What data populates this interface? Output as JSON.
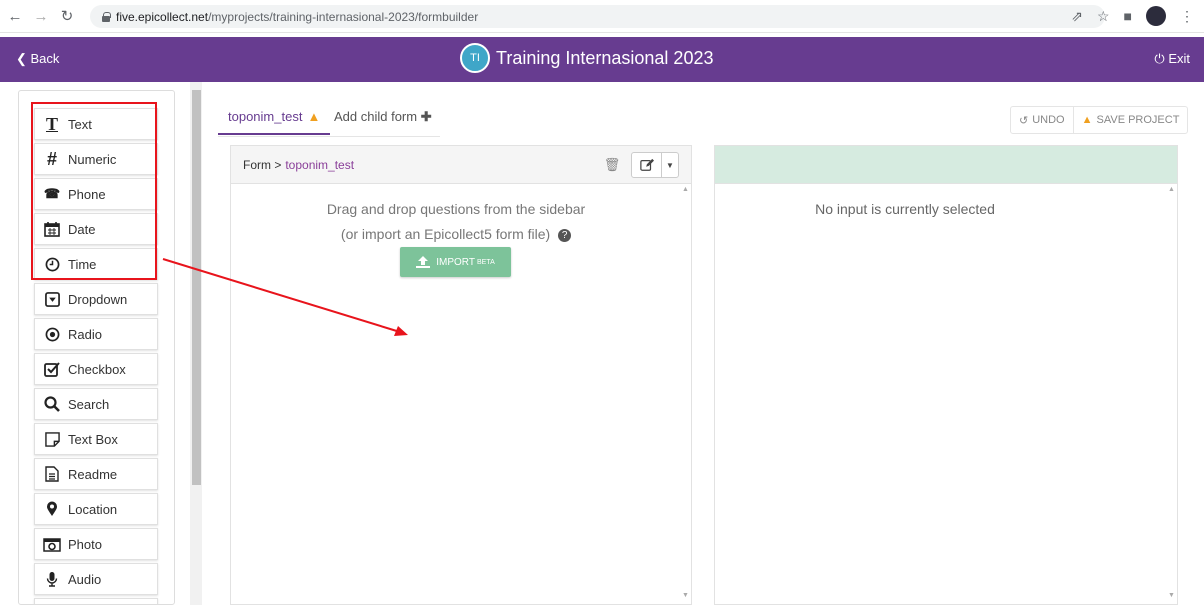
{
  "browser": {
    "url_host": "five.epicollect.net",
    "url_path": "/myprojects/training-internasional-2023/formbuilder"
  },
  "header": {
    "back_label": "Back",
    "avatar_initials": "TI",
    "title": "Training Internasional 2023",
    "exit_label": "Exit",
    "color": "#673c90"
  },
  "sidebar": {
    "items": [
      {
        "label": "Text",
        "icon": "text-icon"
      },
      {
        "label": "Numeric",
        "icon": "hash-icon"
      },
      {
        "label": "Phone",
        "icon": "phone-icon"
      },
      {
        "label": "Date",
        "icon": "calendar-icon"
      },
      {
        "label": "Time",
        "icon": "clock-icon"
      },
      {
        "label": "Dropdown",
        "icon": "dropdown-icon"
      },
      {
        "label": "Radio",
        "icon": "radio-icon"
      },
      {
        "label": "Checkbox",
        "icon": "checkbox-icon"
      },
      {
        "label": "Search",
        "icon": "search-icon"
      },
      {
        "label": "Text Box",
        "icon": "textbox-icon"
      },
      {
        "label": "Readme",
        "icon": "readme-icon"
      },
      {
        "label": "Location",
        "icon": "location-pin-icon"
      },
      {
        "label": "Photo",
        "icon": "camera-icon"
      },
      {
        "label": "Audio",
        "icon": "microphone-icon"
      }
    ]
  },
  "tabs": {
    "active": "toponim_test",
    "child": "Add child form"
  },
  "toolbar": {
    "undo_label": "UNDO",
    "save_label": "SAVE PROJECT"
  },
  "form": {
    "breadcrumb_root": "Form >",
    "breadcrumb_name": "toponim_test",
    "drag_text": "Drag and drop questions from the sidebar",
    "import_text": "(or import an Epicollect5 form file)",
    "import_button": "IMPORT",
    "import_badge": "BETA"
  },
  "details": {
    "empty_text": "No input is currently selected",
    "header_color": "#d6ebe0"
  },
  "annotation_color": "#e8141c"
}
